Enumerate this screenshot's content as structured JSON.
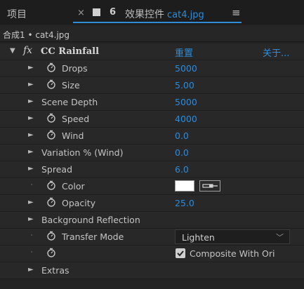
{
  "tabs": {
    "project": "项目",
    "close_glyph": "×",
    "effect_controls": "效果控件",
    "file_name": "cat4.jpg",
    "menu_glyph": "≡"
  },
  "breadcrumb": "合成1 • cat4.jpg",
  "effect": {
    "fx_glyph": "fx",
    "name": "CC Rainfall",
    "reset": "重置",
    "about": "关于..."
  },
  "properties": [
    {
      "label": "Drops",
      "value": "5000"
    },
    {
      "label": "Size",
      "value": "5.00"
    },
    {
      "label": "Scene Depth",
      "value": "5000"
    },
    {
      "label": "Speed",
      "value": "4000"
    },
    {
      "label": "Wind",
      "value": "0.0"
    },
    {
      "label": "Variation % (Wind)",
      "value": "0.0"
    },
    {
      "label": "Spread",
      "value": "6.0"
    },
    {
      "label": "Color",
      "value": ""
    },
    {
      "label": "Opacity",
      "value": "25.0"
    },
    {
      "label": "Background Reflection",
      "value": ""
    },
    {
      "label": "Transfer Mode",
      "value": "Lighten"
    },
    {
      "label": "",
      "value": "Composite With Ori"
    },
    {
      "label": "Extras",
      "value": ""
    }
  ],
  "colors": {
    "accent": "#2e8bd8",
    "panel_bg": "#282828",
    "rain_color": "#ffffff"
  },
  "icons": {
    "stopwatch": "stopwatch-icon",
    "expand": "expand-triangle-icon",
    "lock": "lock-icon",
    "eyedropper": "eyedropper-icon"
  }
}
